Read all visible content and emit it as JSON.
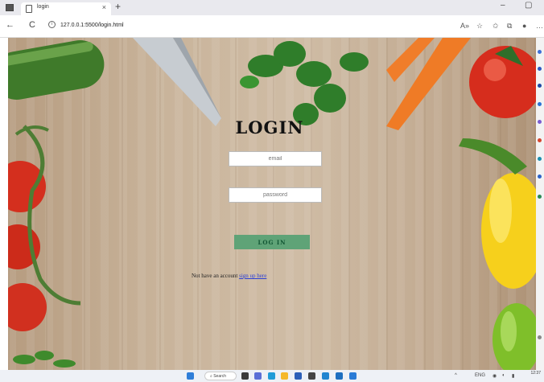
{
  "browser": {
    "tab_title": "login",
    "tab_close": "×",
    "new_tab": "+",
    "back": "←",
    "reload": "C",
    "url": "127.0.0.1:5500/login.html",
    "minimize": "–",
    "restore": "▢",
    "read_aloud": "A»",
    "favorite": "☆",
    "favorites": "✩",
    "collections": "⧉",
    "profile": "●",
    "more": "…"
  },
  "login": {
    "title": "LOGIN",
    "email_placeholder": "email",
    "password_placeholder": "password",
    "submit_label": "LOG IN",
    "signup_prompt": "Not have an account ",
    "signup_link": "sign up here"
  },
  "taskbar": {
    "search_label": "Search",
    "lang": "ENG",
    "time": "12:37"
  },
  "colors": {
    "button": "#5fa377",
    "link": "#2a3fd8"
  }
}
